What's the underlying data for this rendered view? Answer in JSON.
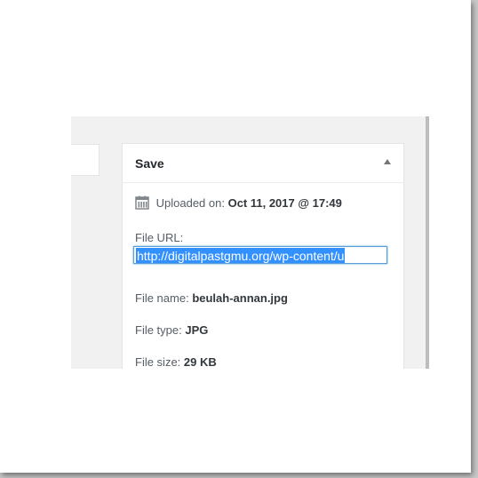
{
  "metabox": {
    "title": "Save",
    "uploaded_label": "Uploaded on:",
    "uploaded_value": "Oct 11, 2017 @ 17:49",
    "file_url_label": "File URL:",
    "file_url_value": "http://digitalpastgmu.org/wp-content/u",
    "file_name_label": "File name:",
    "file_name_value": "beulah-annan.jpg",
    "file_type_label": "File type:",
    "file_type_value": "JPG",
    "file_size_label": "File size:",
    "file_size_value": "29 KB"
  },
  "icons": {
    "calendar": "calendar-icon",
    "toggle": "arrow-up-icon"
  },
  "colors": {
    "selection": "#3390ff",
    "focus_border": "#5b9dd9",
    "text": "#555d66",
    "panel_bg": "#f1f1f1"
  }
}
